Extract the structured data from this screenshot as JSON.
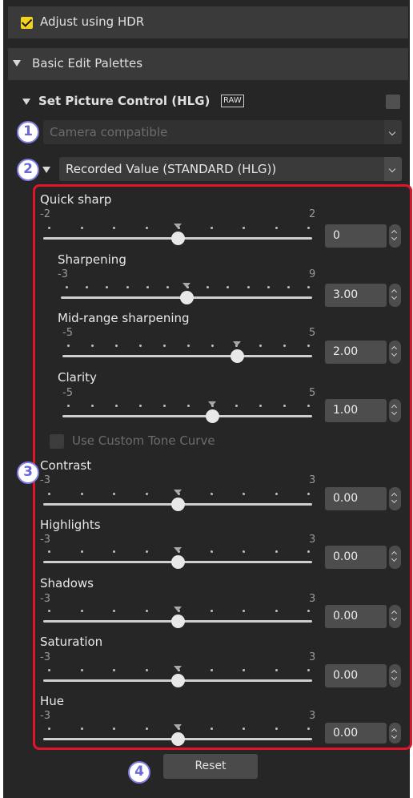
{
  "hdr_checkbox": {
    "label": "Adjust using HDR",
    "checked": true
  },
  "basic_edit": {
    "label": "Basic Edit Palettes"
  },
  "picture_control": {
    "title": "Set Picture Control (HLG)",
    "raw_badge": "RAW"
  },
  "camera_select": {
    "value": "Camera compatible"
  },
  "recorded_select": {
    "value": "Recorded Value (STANDARD (HLG))"
  },
  "sliders": {
    "quick_sharp": {
      "label": "Quick sharp",
      "min": "-2",
      "max": "2",
      "value": "0"
    },
    "sharpening": {
      "label": "Sharpening",
      "min": "-3",
      "max": "9",
      "value": "3.00"
    },
    "mid_range": {
      "label": "Mid-range sharpening",
      "min": "-5",
      "max": "5",
      "value": "2.00"
    },
    "clarity": {
      "label": "Clarity",
      "min": "-5",
      "max": "5",
      "value": "1.00"
    },
    "contrast": {
      "label": "Contrast",
      "min": "-3",
      "max": "3",
      "value": "0.00"
    },
    "highlights": {
      "label": "Highlights",
      "min": "-3",
      "max": "3",
      "value": "0.00"
    },
    "shadows": {
      "label": "Shadows",
      "min": "-3",
      "max": "3",
      "value": "0.00"
    },
    "saturation": {
      "label": "Saturation",
      "min": "-3",
      "max": "3",
      "value": "0.00"
    },
    "hue": {
      "label": "Hue",
      "min": "-3",
      "max": "3",
      "value": "0.00"
    }
  },
  "custom_tone": {
    "label": "Use Custom Tone Curve"
  },
  "reset": {
    "label": "Reset"
  },
  "callouts": {
    "c1": "1",
    "c2": "2",
    "c3": "3",
    "c4": "4"
  },
  "colors": {
    "accent": "#f3d21b",
    "highlight": "#e0152a",
    "callout": "#7c7ae0"
  }
}
